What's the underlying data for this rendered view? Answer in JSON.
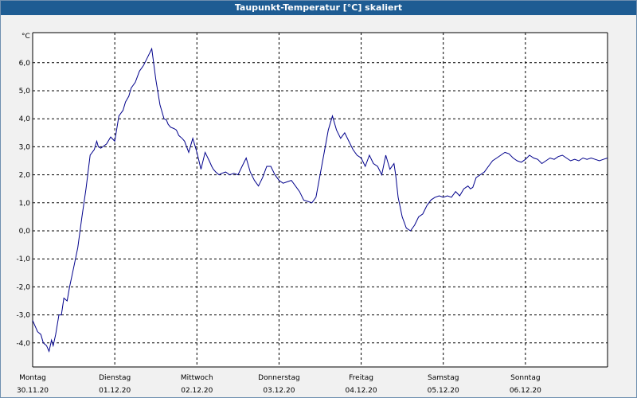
{
  "window": {
    "title": "Taupunkt-Temperatur [°C] skaliert"
  },
  "colors": {
    "titlebar": "#1e5c93",
    "line": "#00008b",
    "background": "#f1f1f1",
    "grid": "#000000"
  },
  "chart_data": {
    "type": "line",
    "title": "Taupunkt-Temperatur [°C] skaliert",
    "unit_label": "°C",
    "grid": true,
    "grid_style": "dashed",
    "ylim": [
      -4.8,
      7.0
    ],
    "xlim": [
      0,
      7
    ],
    "y_ticks": [
      "6,0",
      "5,0",
      "4,0",
      "3,0",
      "2,0",
      "1,0",
      "0,0",
      "-1,0",
      "-2,0",
      "-3,0",
      "-4,0"
    ],
    "y_tick_values": [
      6,
      5,
      4,
      3,
      2,
      1,
      0,
      -1,
      -2,
      -3,
      -4
    ],
    "x_ticks": [
      {
        "day": "Montag",
        "date": "30.11.20",
        "x": 0
      },
      {
        "day": "Dienstag",
        "date": "01.12.20",
        "x": 1
      },
      {
        "day": "Mittwoch",
        "date": "02.12.20",
        "x": 2
      },
      {
        "day": "Donnerstag",
        "date": "03.12.20",
        "x": 3
      },
      {
        "day": "Freitag",
        "date": "04.12.20",
        "x": 4
      },
      {
        "day": "Samstag",
        "date": "05.12.20",
        "x": 5
      },
      {
        "day": "Sonntag",
        "date": "06.12.20",
        "x": 6
      }
    ],
    "series": [
      {
        "x": [
          0,
          0.03,
          0.06,
          0.1,
          0.13,
          0.17,
          0.2,
          0.23,
          0.25,
          0.28,
          0.32,
          0.35,
          0.38,
          0.42,
          0.45,
          0.5,
          0.55,
          0.6,
          0.65,
          0.7,
          0.75,
          0.78,
          0.8,
          0.83,
          0.9,
          0.95,
          1.0,
          1.05,
          1.1,
          1.13,
          1.17,
          1.2,
          1.25,
          1.3,
          1.35,
          1.4,
          1.45,
          1.5,
          1.55,
          1.6,
          1.63,
          1.65,
          1.68,
          1.72,
          1.75,
          1.78,
          1.82,
          1.85,
          1.9,
          1.95,
          2.0,
          2.05,
          2.1,
          2.15,
          2.18,
          2.2,
          2.23,
          2.27,
          2.3,
          2.35,
          2.4,
          2.45,
          2.5,
          2.55,
          2.6,
          2.65,
          2.7,
          2.75,
          2.8,
          2.85,
          2.9,
          2.95,
          3.0,
          3.05,
          3.1,
          3.15,
          3.2,
          3.25,
          3.3,
          3.35,
          3.4,
          3.45,
          3.5,
          3.55,
          3.6,
          3.65,
          3.7,
          3.75,
          3.8,
          3.85,
          3.9,
          3.95,
          4.0,
          4.05,
          4.1,
          4.15,
          4.2,
          4.25,
          4.3,
          4.35,
          4.4,
          4.42,
          4.45,
          4.5,
          4.55,
          4.6,
          4.65,
          4.7,
          4.75,
          4.8,
          4.85,
          4.9,
          4.95,
          5.0,
          5.05,
          5.1,
          5.15,
          5.2,
          5.25,
          5.3,
          5.33,
          5.36,
          5.4,
          5.45,
          5.5,
          5.55,
          5.6,
          5.65,
          5.7,
          5.75,
          5.8,
          5.85,
          5.9,
          5.95,
          6.0,
          6.05,
          6.1,
          6.15,
          6.2,
          6.25,
          6.3,
          6.35,
          6.4,
          6.45,
          6.5,
          6.55,
          6.6,
          6.65,
          6.7,
          6.75,
          6.8,
          6.85,
          6.9,
          6.95,
          7.0
        ],
        "values": [
          -3.2,
          -3.4,
          -3.6,
          -3.7,
          -4.0,
          -4.1,
          -4.3,
          -3.9,
          -4.1,
          -3.7,
          -3.0,
          -3.0,
          -2.4,
          -2.5,
          -2.0,
          -1.3,
          -0.6,
          0.5,
          1.5,
          2.7,
          2.9,
          3.2,
          3.0,
          2.95,
          3.1,
          3.35,
          3.2,
          4.1,
          4.3,
          4.6,
          4.8,
          5.1,
          5.3,
          5.7,
          5.9,
          6.2,
          6.5,
          5.4,
          4.5,
          4.0,
          3.95,
          3.8,
          3.7,
          3.65,
          3.6,
          3.4,
          3.3,
          3.2,
          2.8,
          3.3,
          2.8,
          2.2,
          2.8,
          2.5,
          2.3,
          2.2,
          2.1,
          2.0,
          2.05,
          2.1,
          2.0,
          2.05,
          2.0,
          2.3,
          2.6,
          2.1,
          1.8,
          1.6,
          1.9,
          2.3,
          2.3,
          2.0,
          1.8,
          1.7,
          1.75,
          1.8,
          1.6,
          1.4,
          1.1,
          1.05,
          1.0,
          1.2,
          2.0,
          2.8,
          3.6,
          4.1,
          3.6,
          3.3,
          3.5,
          3.2,
          2.9,
          2.7,
          2.6,
          2.3,
          2.7,
          2.4,
          2.3,
          2.0,
          2.7,
          2.2,
          2.4,
          2.0,
          1.2,
          0.5,
          0.1,
          0.0,
          0.2,
          0.5,
          0.6,
          0.9,
          1.1,
          1.2,
          1.25,
          1.2,
          1.25,
          1.2,
          1.4,
          1.25,
          1.5,
          1.6,
          1.5,
          1.55,
          1.9,
          2.0,
          2.1,
          2.3,
          2.5,
          2.6,
          2.7,
          2.8,
          2.75,
          2.6,
          2.5,
          2.45,
          2.55,
          2.7,
          2.6,
          2.55,
          2.4,
          2.5,
          2.6,
          2.55,
          2.65,
          2.7,
          2.6,
          2.5,
          2.55,
          2.5,
          2.6,
          2.55,
          2.6,
          2.55,
          2.5,
          2.55,
          2.6
        ]
      }
    ]
  }
}
